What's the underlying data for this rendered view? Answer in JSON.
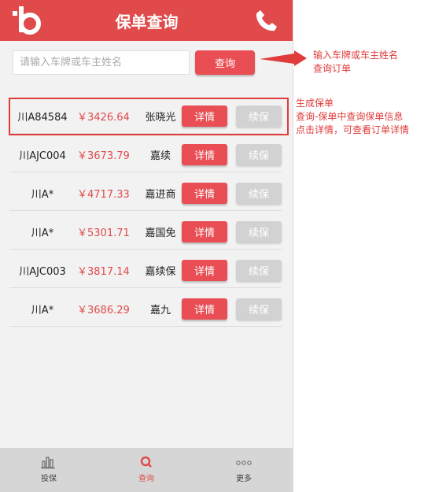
{
  "header": {
    "title": "保单查询"
  },
  "search": {
    "placeholder": "请输入车牌或车主姓名",
    "button_label": "查询"
  },
  "policies": [
    {
      "plate": "川A84584",
      "price": "￥3426.64",
      "name": "张晓光",
      "detail_label": "详情",
      "renew_label": "续保"
    },
    {
      "plate": "川AJC004",
      "price": "￥3673.79",
      "name": "嘉续",
      "detail_label": "详情",
      "renew_label": "续保"
    },
    {
      "plate": "川A*",
      "price": "￥4717.33",
      "name": "嘉进商",
      "detail_label": "详情",
      "renew_label": "续保"
    },
    {
      "plate": "川A*",
      "price": "￥5301.71",
      "name": "嘉国免",
      "detail_label": "详情",
      "renew_label": "续保"
    },
    {
      "plate": "川AJC003",
      "price": "￥3817.14",
      "name": "嘉续保",
      "detail_label": "详情",
      "renew_label": "续保"
    },
    {
      "plate": "川A*",
      "price": "￥3686.29",
      "name": "嘉九",
      "detail_label": "详情",
      "renew_label": "续保"
    }
  ],
  "tabbar": {
    "items": [
      {
        "label": "投保",
        "icon": "bar-chart-icon"
      },
      {
        "label": "查询",
        "icon": "search-icon",
        "active": true
      },
      {
        "label": "更多",
        "icon": "more-dots-icon"
      }
    ]
  },
  "annotations": {
    "search_line1": "输入车牌或车主姓名",
    "search_line2": "查询订单",
    "list_line1": "生成保单",
    "list_line2": "查询-保单中查询保单信息",
    "list_line3": "点击详情，可查看订单详情"
  },
  "colors": {
    "brand_red": "#e04a4a",
    "button_red": "#e94e55",
    "renew_gray": "#d2d2d2",
    "annotation_red": "#e03c3c"
  }
}
